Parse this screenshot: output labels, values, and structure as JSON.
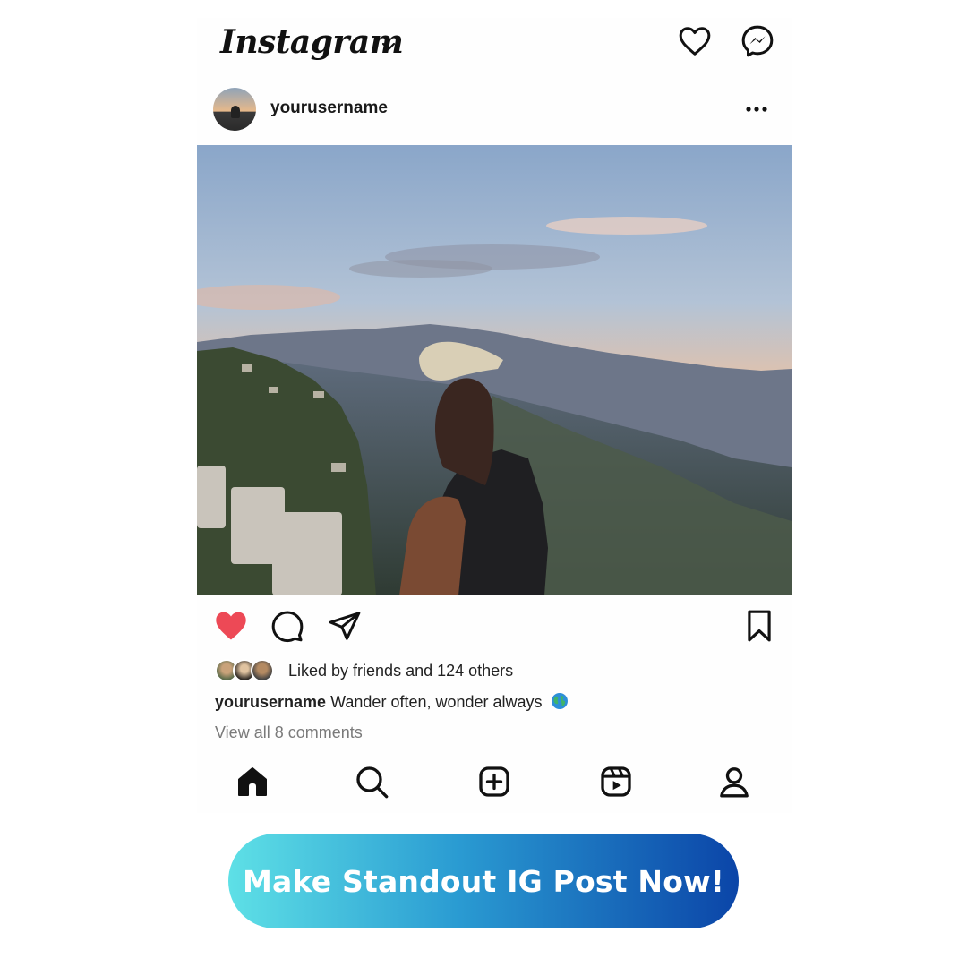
{
  "app": {
    "logo_text": "Instagram"
  },
  "post": {
    "username": "yourusername",
    "likes_text": "Liked by friends and 124 others",
    "caption_user": "yourusername",
    "caption_text": "Wander often, wonder always",
    "comments_link": "View all 8 comments",
    "liked": true
  },
  "icons": {
    "top": [
      "chevron-down-icon",
      "heart-icon",
      "messenger-icon"
    ],
    "post_header": [
      "more-icon"
    ],
    "actions": [
      "heart-filled-icon",
      "comment-icon",
      "share-icon",
      "bookmark-icon"
    ],
    "bottom_nav": [
      "home-icon",
      "search-icon",
      "create-icon",
      "reels-icon",
      "profile-icon"
    ]
  },
  "cta": {
    "label": "Make Standout IG Post Now!"
  },
  "colors": {
    "like_red": "#ed4956",
    "cta_start": "#5ee0e6",
    "cta_end": "#0b45a8"
  }
}
